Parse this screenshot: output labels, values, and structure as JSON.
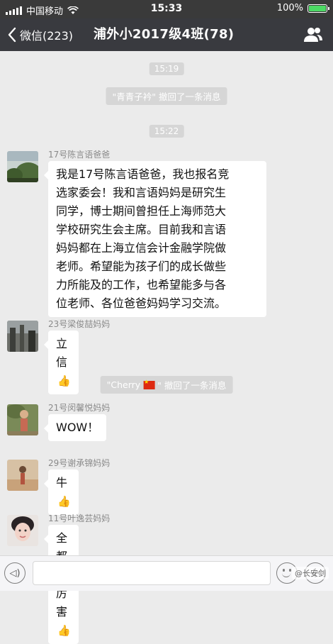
{
  "status_bar": {
    "carrier": "中国移动",
    "time": "15:33",
    "battery_text": "100%",
    "battery_level": 1.0
  },
  "nav": {
    "back_label": "微信(223)",
    "title": "浦外小2017级4班(78)"
  },
  "chat": {
    "time_1": "15:19",
    "recall_1": "\"青青子衿\" 撤回了一条消息",
    "time_2": "15:22",
    "recall_2_name": "\"Cherry",
    "recall_2_rest": "\" 撤回了一条消息",
    "messages": [
      {
        "sender": "17号陈言语爸爸",
        "lines": [
          "我是17号陈言语爸爸，我也报名竞",
          "选家委会！我和言语妈妈是研究生",
          "同学，博士期间曾担任上海师范大",
          "学校研究生会主席。目前我和言语",
          "妈妈都在上海立信会计金融学院做",
          "老师。希望能为孩子们的成长做些",
          "力所能及的工作，也希望能多与各",
          "位老师、各位爸爸妈妈学习交流。"
        ]
      },
      {
        "sender": "23号梁俊喆妈妈",
        "text": "立信",
        "has_thumb": true
      },
      {
        "sender": "21号闵馨悦妈妈",
        "text": "WOW！",
        "has_thumb": false
      },
      {
        "sender": "29号谢承锦妈妈",
        "text": "牛",
        "has_thumb": true
      },
      {
        "sender": "11号叶逸芸妈妈",
        "text": "全都好厉害",
        "has_thumb": true
      }
    ]
  },
  "input": {
    "voice_icon": "voice-icon",
    "emoji_icon": "emoji-icon",
    "plus_icon": "plus-icon"
  },
  "watermark": "@长安剑",
  "colors": {
    "nav_bg": "#393a3f",
    "chat_bg": "#ebebeb",
    "thumb": "#e7a531"
  }
}
